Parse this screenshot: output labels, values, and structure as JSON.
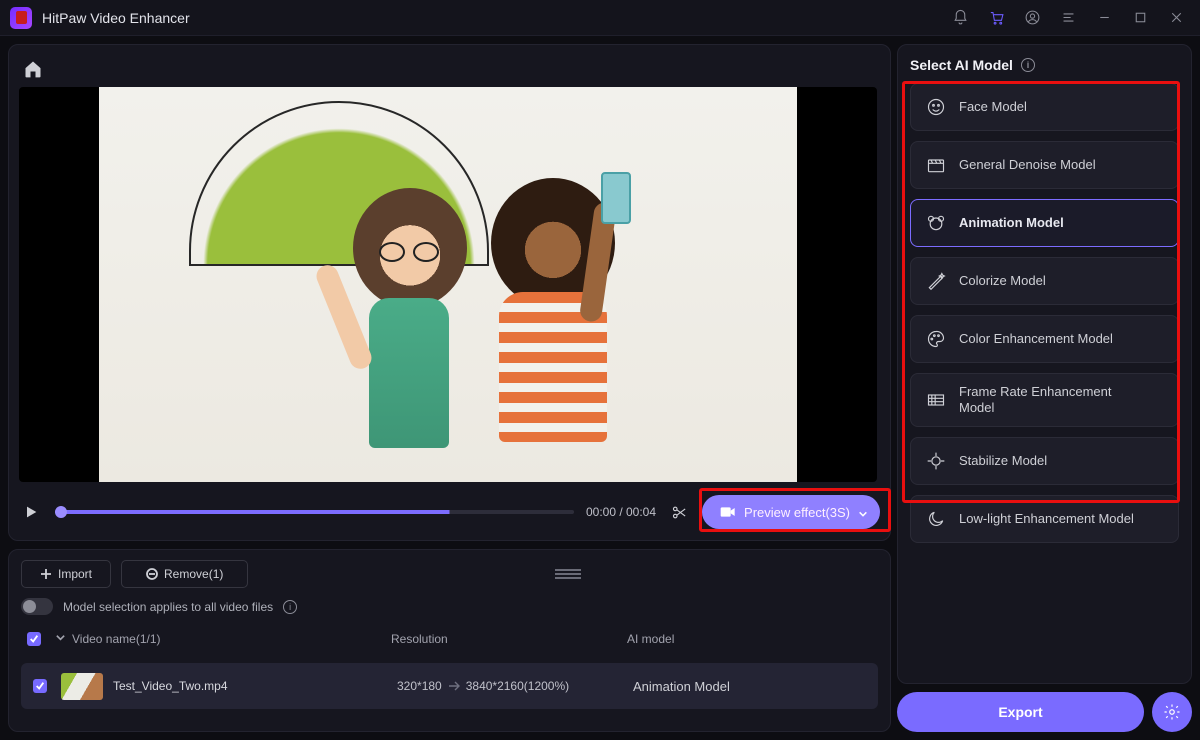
{
  "app": {
    "title": "HitPaw Video Enhancer"
  },
  "timeline": {
    "display": "00:00 / 00:04"
  },
  "preview_button": {
    "label": "Preview effect(3S)"
  },
  "list": {
    "import_label": "Import",
    "remove_label": "Remove(1)",
    "toggle_label": "Model selection applies to all video files",
    "headers": {
      "name": "Video name(1/1)",
      "resolution": "Resolution",
      "model": "AI model"
    },
    "row": {
      "filename": "Test_Video_Two.mp4",
      "res_in": "320*180",
      "res_out": "3840*2160(1200%)",
      "model": "Animation Model"
    }
  },
  "right": {
    "title": "Select AI Model",
    "models": [
      "Face Model",
      "General Denoise Model",
      "Animation Model",
      "Colorize Model",
      "Color Enhancement Model",
      "Frame Rate Enhancement Model",
      "Stabilize Model",
      "Low-light Enhancement Model"
    ],
    "export_label": "Export"
  }
}
